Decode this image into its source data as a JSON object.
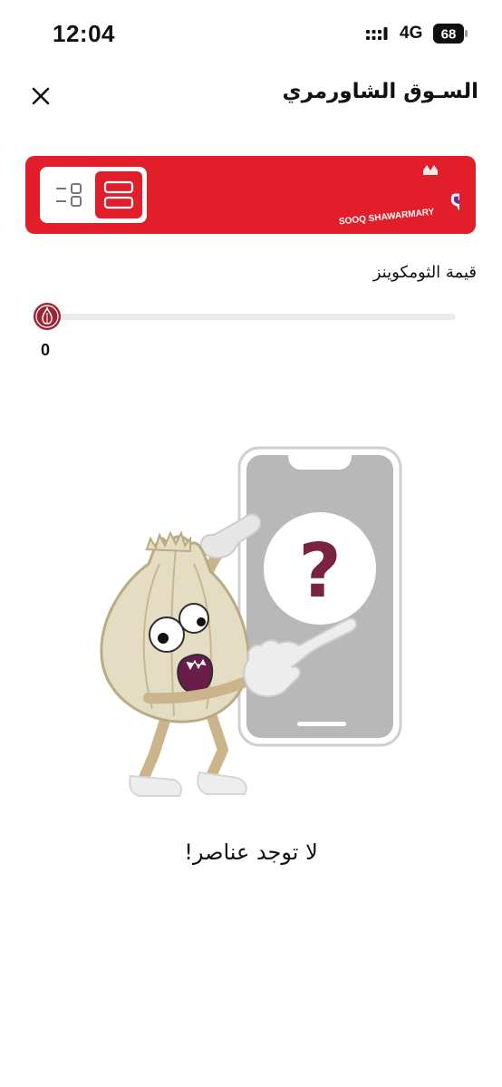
{
  "status_bar": {
    "time": "12:04",
    "network": "4G",
    "battery": "68"
  },
  "header": {
    "title": "السـوق الشاورمري",
    "close_icon": "close-icon"
  },
  "banner": {
    "logo_text_ar": "السوق الشاورمري",
    "logo_text_en": "SOOQ SHAWARMARY",
    "background_color": "#e31e2b",
    "view_options": [
      "list-view-icon",
      "grid-view-icon"
    ],
    "selected_view": "grid"
  },
  "filter": {
    "label": "قيمة الثومكوينز",
    "value": "0",
    "thumb_icon": "garlic-coin-icon"
  },
  "empty_state": {
    "message": "لا توجد عناصر!",
    "illustration": "garlic-mascot-with-phone",
    "question_mark": "?"
  },
  "colors": {
    "accent": "#e31e2b",
    "question": "#7a2340"
  }
}
